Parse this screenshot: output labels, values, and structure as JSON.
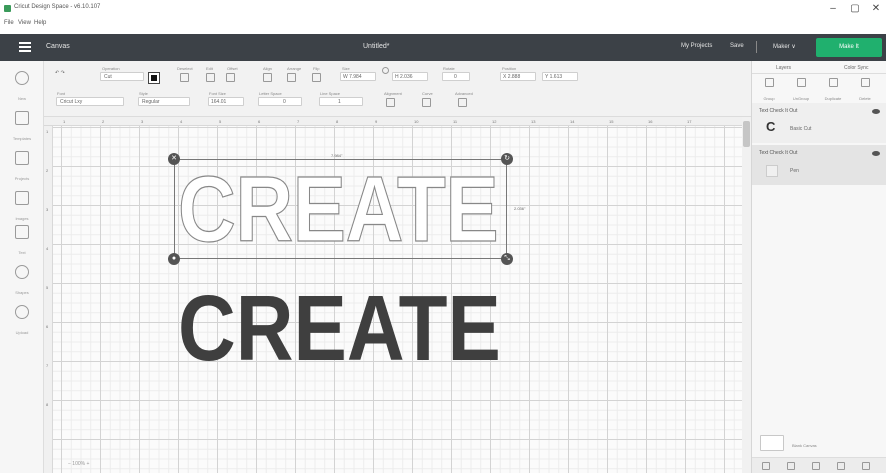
{
  "window": {
    "title": "Cricut Design Space - v6.10.107",
    "minimize": "–",
    "maximize": "▢",
    "close": "✕"
  },
  "menu": [
    "File",
    "View",
    "Help"
  ],
  "header": {
    "canvas_label": "Canvas",
    "doc_title": "Untitled*",
    "my_projects": "My Projects",
    "save": "Save",
    "separator": "|",
    "machine": "Maker ∨",
    "make_it": "Make It"
  },
  "toolbar": {
    "undo_redo": "↶ ↷",
    "operation_label": "Operation",
    "operation_value": "Cut",
    "deselect_label": "Deselect",
    "edit_label": "Edit",
    "offset_label": "Offset",
    "align_label": "Align",
    "arrange_label": "Arrange",
    "flip_label": "Flip",
    "size_label": "Size",
    "size_w": "W 7.984",
    "size_h": "H 2.036",
    "rotate_label": "Rotate",
    "rotate_value": "0",
    "position_label": "Position",
    "position_x": "X 2.888",
    "position_y": "Y 1.613",
    "font_label": "Font",
    "font_value": "Cricut Lxy",
    "style_label": "Style",
    "style_value": "Regular",
    "font_size_label": "Font Size",
    "font_size_value": "164.01",
    "letter_space_label": "Letter Space",
    "letter_space_value": "0",
    "line_space_label": "Line Space",
    "line_space_value": "1",
    "alignment_label": "Alignment",
    "curve_label": "Curve",
    "advanced_label": "Advanced"
  },
  "left_rail": [
    {
      "label": "New",
      "icon": "new-icon"
    },
    {
      "label": "Templates",
      "icon": "templates-icon"
    },
    {
      "label": "Projects",
      "icon": "projects-icon"
    },
    {
      "label": "Images",
      "icon": "images-icon"
    },
    {
      "label": "Text",
      "icon": "text-icon"
    },
    {
      "label": "Shapes",
      "icon": "shapes-icon"
    },
    {
      "label": "Upload",
      "icon": "upload-icon"
    }
  ],
  "ruler": {
    "top": [
      "1",
      "2",
      "3",
      "4",
      "5",
      "6",
      "7",
      "8",
      "9",
      "10",
      "11",
      "12",
      "13",
      "14",
      "15",
      "16",
      "17"
    ],
    "left": [
      "1",
      "2",
      "3",
      "4",
      "5",
      "6",
      "7",
      "8"
    ]
  },
  "canvas": {
    "outline_text": "CREATE",
    "solid_text": "CREATE",
    "width_readout": "7.984\"",
    "height_readout": "2.036\"",
    "zoom": "−  100%  +"
  },
  "layers_panel": {
    "tab_layers": "Layers",
    "tab_color_sync": "Color Sync",
    "tools": [
      "Group",
      "UnGroup",
      "Duplicate",
      "Delete"
    ],
    "groups": [
      {
        "title": "Text   Check It Out",
        "layer_name": "Basic Cut",
        "thumb": "C"
      },
      {
        "title": "Text   Check It Out",
        "layer_name": "Pen",
        "thumb": ""
      }
    ],
    "blank_canvas": "Blank Canvas",
    "bottom_tools": [
      "slice-icon",
      "weld-icon",
      "attach-icon",
      "flatten-icon",
      "contour-icon"
    ]
  }
}
